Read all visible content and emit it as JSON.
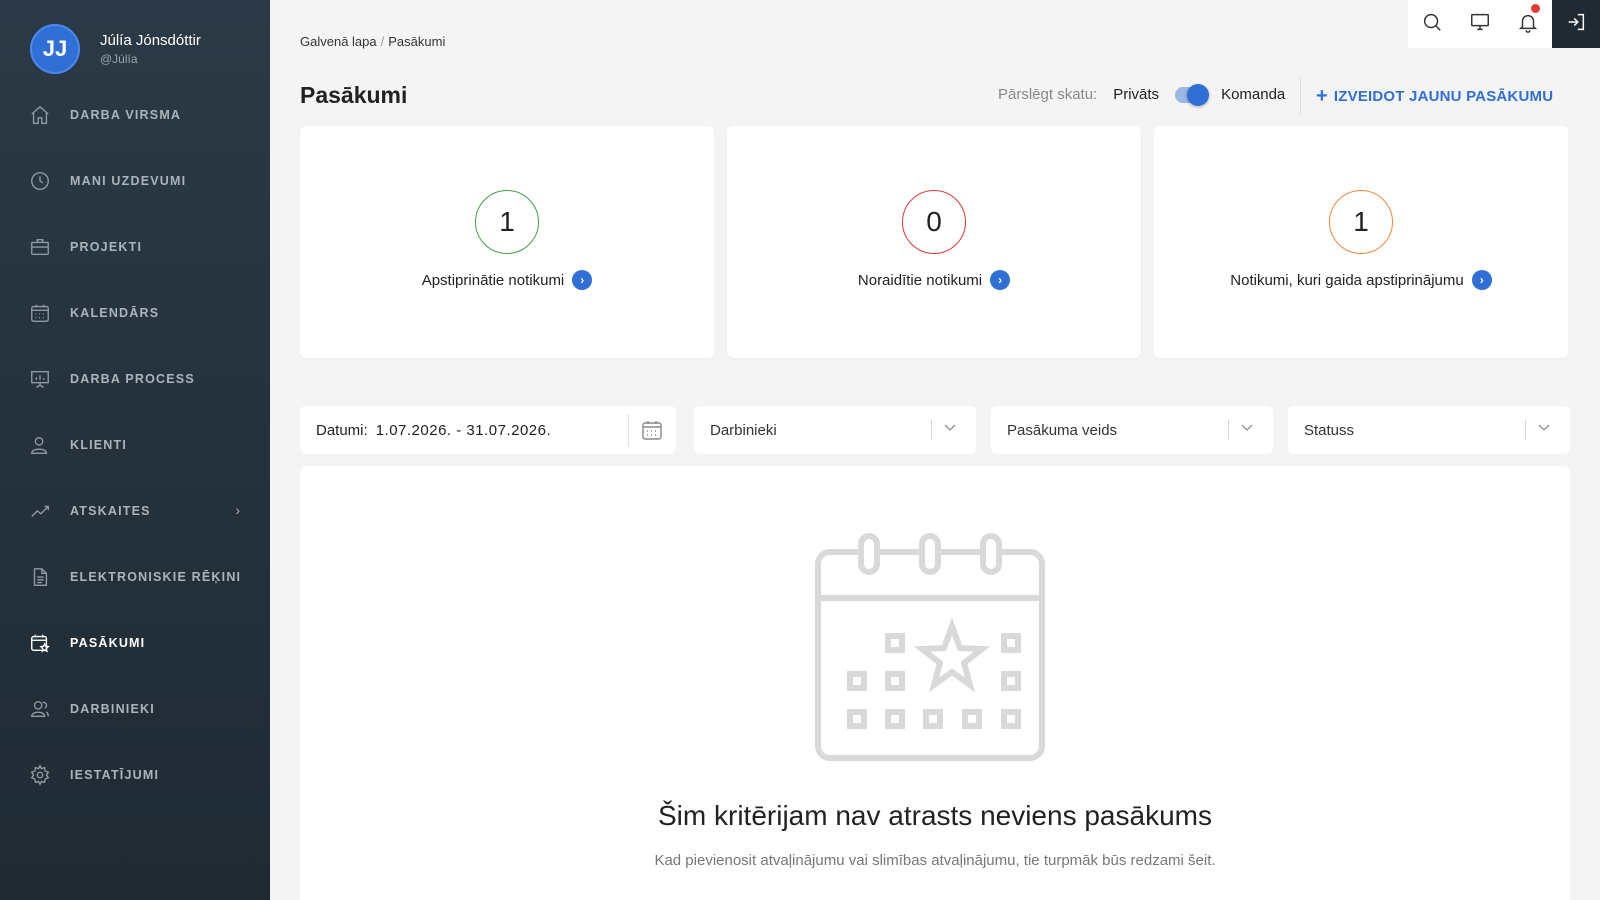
{
  "user": {
    "initials": "JJ",
    "name": "Júlía Jónsdóttir",
    "handle": "@Júlía"
  },
  "nav": {
    "items": [
      {
        "label": "DARBA VIRSMA",
        "icon": "home-icon"
      },
      {
        "label": "MANI UZDEVUMI",
        "icon": "clock-icon"
      },
      {
        "label": "PROJEKTI",
        "icon": "briefcase-icon"
      },
      {
        "label": "KALENDĀRS",
        "icon": "calendar-icon"
      },
      {
        "label": "DARBA PROCESS",
        "icon": "presentation-board-icon"
      },
      {
        "label": "KLIENTI",
        "icon": "user-icon"
      },
      {
        "label": "ATSKAITES",
        "icon": "chart-line-icon"
      },
      {
        "label": "ELEKTRONISKIE RĒĶINI",
        "icon": "document-icon"
      },
      {
        "label": "PASĀKUMI",
        "icon": "calendar-star-icon",
        "active": true
      },
      {
        "label": "DARBINIEKI",
        "icon": "users-icon"
      },
      {
        "label": "IESTATĪJUMI",
        "icon": "gear-icon"
      }
    ]
  },
  "breadcrumb": {
    "home": "Galvenā lapa",
    "current": "Pasākumi"
  },
  "page": {
    "title": "Pasākumi"
  },
  "view_switch": {
    "label": "Pārslēgt skatu:",
    "private": "Privāts",
    "team": "Komanda",
    "selected": "Komanda"
  },
  "create_button": {
    "label": "IZVEIDOT JAUNU PASĀKUMU"
  },
  "stats": [
    {
      "value": "1",
      "label": "Apstiprinātie notikumi",
      "color": "#43a047"
    },
    {
      "value": "0",
      "label": "Noraidītie notikumi",
      "color": "#e53935"
    },
    {
      "value": "1",
      "label": "Notikumi, kuri gaida apstiprinājumu",
      "color": "#f08a3c"
    }
  ],
  "filters": {
    "date_label": "Datumi:",
    "date_value": "1.07.2026. - 31.07.2026.",
    "employees": "Darbinieki",
    "event_type": "Pasākuma veids",
    "status": "Statuss"
  },
  "empty_state": {
    "title": "Šim kritērijam nav atrasts neviens pasākums",
    "subtitle": "Kad pievienosit atvaļinājumu vai slimības atvaļinājumu, tie turpmāk būs redzami šeit."
  },
  "colors": {
    "accent": "#2f6fd6",
    "sidebar": "#27343f"
  }
}
